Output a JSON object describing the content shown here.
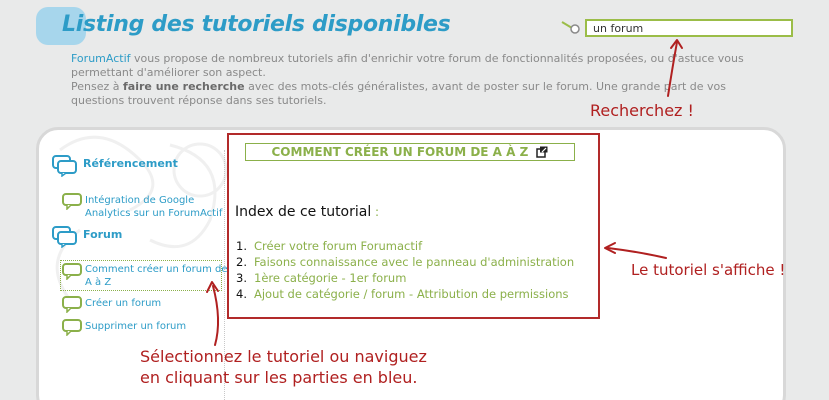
{
  "header": {
    "title": "Listing des tutoriels disponibles",
    "search": {
      "value": "un forum",
      "placeholder": ""
    }
  },
  "intro": {
    "brand": "ForumActif",
    "line1_rest": " vous propose de nombreux tutoriels afin d'enrichir votre forum de fonctionnalités proposées, ou d'astuce vous permettant d'améliorer son aspect.",
    "line2_start": "Pensez à ",
    "line2_bold": "faire une recherche",
    "line2_rest": " avec des mots-clés généralistes, avant de poster sur le forum. Une grande part de vos questions trouvent réponse dans ses tutoriels."
  },
  "sidebar": {
    "categories": [
      {
        "label": "Référencement"
      },
      {
        "label": "Forum"
      }
    ],
    "items": [
      {
        "label_line1": "Intégration de Google",
        "label_line2": "Analytics sur un ForumActif"
      },
      {
        "label_line1": "Comment créer un forum de",
        "label_line2": "A à Z"
      },
      {
        "label_line1": "Créer un forum",
        "label_line2": ""
      },
      {
        "label_line1": "Supprimer un forum",
        "label_line2": ""
      }
    ]
  },
  "tutorial": {
    "title": "COMMENT CRÉER UN FORUM DE A À Z",
    "index_title": "Index de ce tutorial",
    "index_colon": " :",
    "toc": [
      {
        "num": "1.",
        "label": "Créer votre forum Forumactif"
      },
      {
        "num": "2.",
        "label": "Faisons connaissance avec le panneau d'administration"
      },
      {
        "num": "3.",
        "label": "1ère catégorie - 1er forum"
      },
      {
        "num": "4.",
        "label": "Ajout de catégorie / forum - Attribution de permissions"
      }
    ]
  },
  "annotations": {
    "search": "Recherchez !",
    "display": "Le tutoriel s'affiche !",
    "select_line1": "Sélectionnez le tutoriel ou naviguez",
    "select_line2": "en cliquant sur les parties en bleu."
  },
  "colors": {
    "title_blue": "#2d9cc7",
    "link_green": "#8bb04a",
    "annotation_red": "#b02020"
  },
  "icons": [
    "search-magnifier-icon",
    "speech-bubbles-icon",
    "speech-bubble-icon",
    "external-link-icon"
  ]
}
